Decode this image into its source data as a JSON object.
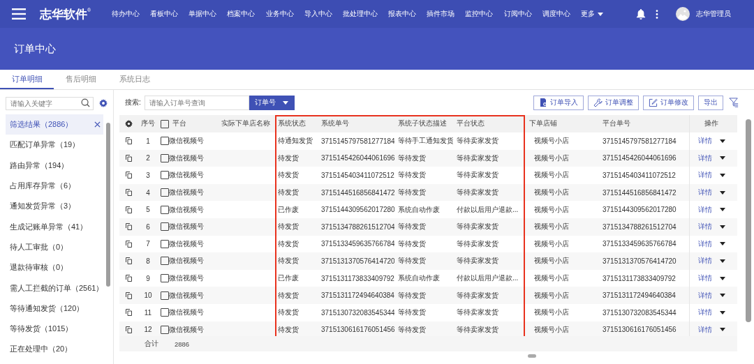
{
  "topbar": {
    "logo": "志华软件",
    "logo_mark": "®",
    "nav": [
      {
        "label": "待办中心"
      },
      {
        "label": "看板中心"
      },
      {
        "label": "单据中心"
      },
      {
        "label": "档案中心"
      },
      {
        "label": "业务中心"
      },
      {
        "label": "导入中心"
      },
      {
        "label": "批处理中心"
      },
      {
        "label": "报表中心"
      },
      {
        "label": "插件市场"
      },
      {
        "label": "监控中心"
      },
      {
        "label": "订阅中心"
      },
      {
        "label": "调度中心"
      }
    ],
    "more": "更多",
    "user": "志华管理员"
  },
  "page_title": "订单中心",
  "tabs": [
    {
      "label": "订单明细",
      "selected": true
    },
    {
      "label": "售后明细",
      "selected": false
    },
    {
      "label": "系统日志",
      "selected": false
    }
  ],
  "sidebar": {
    "search_placeholder": "请输入关键字",
    "items": [
      {
        "label": "筛选结果（2886）",
        "selected": true
      },
      {
        "label": "匹配订单异常（19）",
        "selected": false
      },
      {
        "label": "路由异常（194）",
        "selected": false
      },
      {
        "label": "占用库存异常（6）",
        "selected": false
      },
      {
        "label": "通知发货异常（3）",
        "selected": false
      },
      {
        "label": "生成记账单异常（41）",
        "selected": false
      },
      {
        "label": "待人工审批（0）",
        "selected": false
      },
      {
        "label": "退款待审核（0）",
        "selected": false
      },
      {
        "label": "需人工拦截的订单（2561）",
        "selected": false
      },
      {
        "label": "等待通知发货（120）",
        "selected": false
      },
      {
        "label": "等待发货（1015）",
        "selected": false
      },
      {
        "label": "正在处理中（20）",
        "selected": false
      }
    ]
  },
  "toolbar": {
    "search_label": "搜索:",
    "search_placeholder": "请输入订单号查询",
    "search_type": "订单号",
    "buttons": [
      {
        "kind": "import",
        "label": "订单导入"
      },
      {
        "kind": "adjust",
        "label": "订单调整"
      },
      {
        "kind": "edit",
        "label": "订单修改"
      },
      {
        "kind": "plain",
        "label": "导出"
      }
    ]
  },
  "table": {
    "header_checked": false,
    "columns": [
      {
        "label": "序号",
        "highlighted": false
      },
      {
        "label": "平台",
        "highlighted": false
      },
      {
        "label": "实际下单店名称",
        "highlighted": false
      },
      {
        "label": "系统状态",
        "highlighted": true
      },
      {
        "label": "系统单号",
        "highlighted": true
      },
      {
        "label": "系统子状态描述",
        "highlighted": true
      },
      {
        "label": "平台状态",
        "highlighted": true
      },
      {
        "label": "下单店铺",
        "highlighted": false
      },
      {
        "label": "平台单号",
        "highlighted": false
      },
      {
        "label": "操作",
        "highlighted": false
      }
    ],
    "rows": [
      {
        "index": "1",
        "checked": false,
        "platform": "微信视频号",
        "system_status": "待通知发货",
        "system_no": "3715145797581277184",
        "sub_status": "等待手工通知发货",
        "platform_status": "等待卖家发货",
        "store": "视频号小店",
        "platform_no": "3715145797581277184",
        "action": "详情"
      },
      {
        "index": "2",
        "checked": false,
        "platform": "微信视频号",
        "system_status": "待发货",
        "system_no": "3715145426044061696",
        "sub_status": "等待发货",
        "platform_status": "等待卖家发货",
        "store": "视频号小店",
        "platform_no": "3715145426044061696",
        "action": "详情"
      },
      {
        "index": "3",
        "checked": false,
        "platform": "微信视频号",
        "system_status": "待发货",
        "system_no": "3715145403411072512",
        "sub_status": "等待发货",
        "platform_status": "等待卖家发货",
        "store": "视频号小店",
        "platform_no": "3715145403411072512",
        "action": "详情"
      },
      {
        "index": "4",
        "checked": false,
        "platform": "微信视频号",
        "system_status": "待发货",
        "system_no": "3715144516856841472",
        "sub_status": "等待发货",
        "platform_status": "等待卖家发货",
        "store": "视频号小店",
        "platform_no": "3715144516856841472",
        "action": "详情"
      },
      {
        "index": "5",
        "checked": false,
        "platform": "微信视频号",
        "system_status": "已作废",
        "system_no": "3715144309562017280",
        "sub_status": "系统自动作废",
        "platform_status": "付款以后用户退款...",
        "store": "视频号小店",
        "platform_no": "3715144309562017280",
        "action": "详情"
      },
      {
        "index": "6",
        "checked": false,
        "platform": "微信视频号",
        "system_status": "待发货",
        "system_no": "3715134788261512704",
        "sub_status": "等待发货",
        "platform_status": "等待卖家发货",
        "store": "视频号小店",
        "platform_no": "3715134788261512704",
        "action": "详情"
      },
      {
        "index": "7",
        "checked": false,
        "platform": "微信视频号",
        "system_status": "待发货",
        "system_no": "3715133459635766784",
        "sub_status": "等待发货",
        "platform_status": "等待卖家发货",
        "store": "视频号小店",
        "platform_no": "3715133459635766784",
        "action": "详情"
      },
      {
        "index": "8",
        "checked": false,
        "platform": "微信视频号",
        "system_status": "待发货",
        "system_no": "3715131370576414720",
        "sub_status": "等待发货",
        "platform_status": "等待卖家发货",
        "store": "视频号小店",
        "platform_no": "3715131370576414720",
        "action": "详情"
      },
      {
        "index": "9",
        "checked": false,
        "platform": "微信视频号",
        "system_status": "已作废",
        "system_no": "3715131173833409792",
        "sub_status": "系统自动作废",
        "platform_status": "付款以后用户退款...",
        "store": "视频号小店",
        "platform_no": "3715131173833409792",
        "action": "详情"
      },
      {
        "index": "10",
        "checked": false,
        "platform": "微信视频号",
        "system_status": "待发货",
        "system_no": "3715131172494640384",
        "sub_status": "等待发货",
        "platform_status": "等待卖家发货",
        "store": "视频号小店",
        "platform_no": "3715131172494640384",
        "action": "详情"
      },
      {
        "index": "11",
        "checked": false,
        "platform": "微信视频号",
        "system_status": "待发货",
        "system_no": "3715130732083545344",
        "sub_status": "等待发货",
        "platform_status": "等待卖家发货",
        "store": "视频号小店",
        "platform_no": "3715130732083545344",
        "action": "详情"
      },
      {
        "index": "12",
        "checked": false,
        "platform": "微信视频号",
        "system_status": "待发货",
        "system_no": "3715130616176051456",
        "sub_status": "等待发货",
        "platform_status": "等待卖家发货",
        "store": "视频号小店",
        "platform_no": "3715130616176051456",
        "action": "详情"
      }
    ],
    "footer": {
      "label": "合计",
      "count": "2886"
    }
  }
}
